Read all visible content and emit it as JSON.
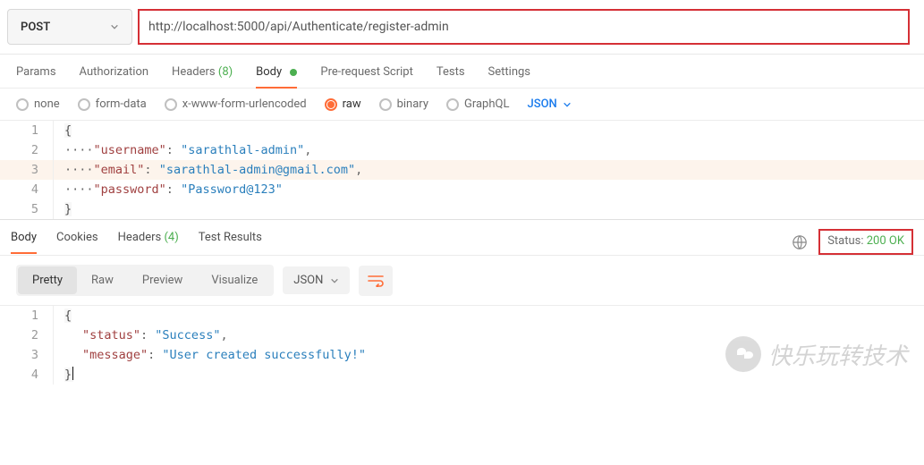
{
  "request": {
    "method": "POST",
    "url": "http://localhost:5000/api/Authenticate/register-admin"
  },
  "top_tabs": {
    "params": "Params",
    "auth": "Authorization",
    "headers_label": "Headers",
    "headers_count": "(8)",
    "body": "Body",
    "prerequest": "Pre-request Script",
    "tests": "Tests",
    "settings": "Settings"
  },
  "body_types": {
    "none": "none",
    "formdata": "form-data",
    "urlencoded": "x-www-form-urlencoded",
    "raw": "raw",
    "binary": "binary",
    "graphql": "GraphQL",
    "json": "JSON"
  },
  "request_body_rows": [
    {
      "n": "1",
      "text": "{",
      "brace": true
    },
    {
      "n": "2",
      "text": "····\"username\": \"sarathlal-admin\","
    },
    {
      "n": "3",
      "text": "····\"email\": \"sarathlal-admin@gmail.com\",",
      "hl": true
    },
    {
      "n": "4",
      "text": "····\"password\": \"Password@123\""
    },
    {
      "n": "5",
      "text": "}",
      "brace": true
    }
  ],
  "request_body": {
    "k1": "\"username\"",
    "v1": "\"sarathlal-admin\"",
    "k2": "\"email\"",
    "v2": "\"sarathlal-admin@gmail.com\"",
    "k3": "\"password\"",
    "v3": "\"Password@123\"",
    "open": "{",
    "close": "}"
  },
  "resp_tabs": {
    "body": "Body",
    "cookies": "Cookies",
    "headers_label": "Headers",
    "headers_count": "(4)",
    "tests": "Test Results"
  },
  "status": {
    "label": "Status:",
    "value": "200 OK"
  },
  "viewbar": {
    "pretty": "Pretty",
    "raw": "Raw",
    "preview": "Preview",
    "visualize": "Visualize",
    "json": "JSON"
  },
  "response_body_rows": [
    {
      "n": "1",
      "text": "{",
      "brace": true
    },
    {
      "n": "2",
      "text": "    \"status\": \"Success\","
    },
    {
      "n": "3",
      "text": "    \"message\": \"User created successfully!\""
    },
    {
      "n": "4",
      "text": "}",
      "brace": true,
      "cursor": true
    }
  ],
  "response_body": {
    "k1": "\"status\"",
    "v1": "\"Success\"",
    "k2": "\"message\"",
    "v2": "\"User created successfully!\"",
    "open": "{",
    "close": "}"
  },
  "watermark": "快乐玩转技术"
}
